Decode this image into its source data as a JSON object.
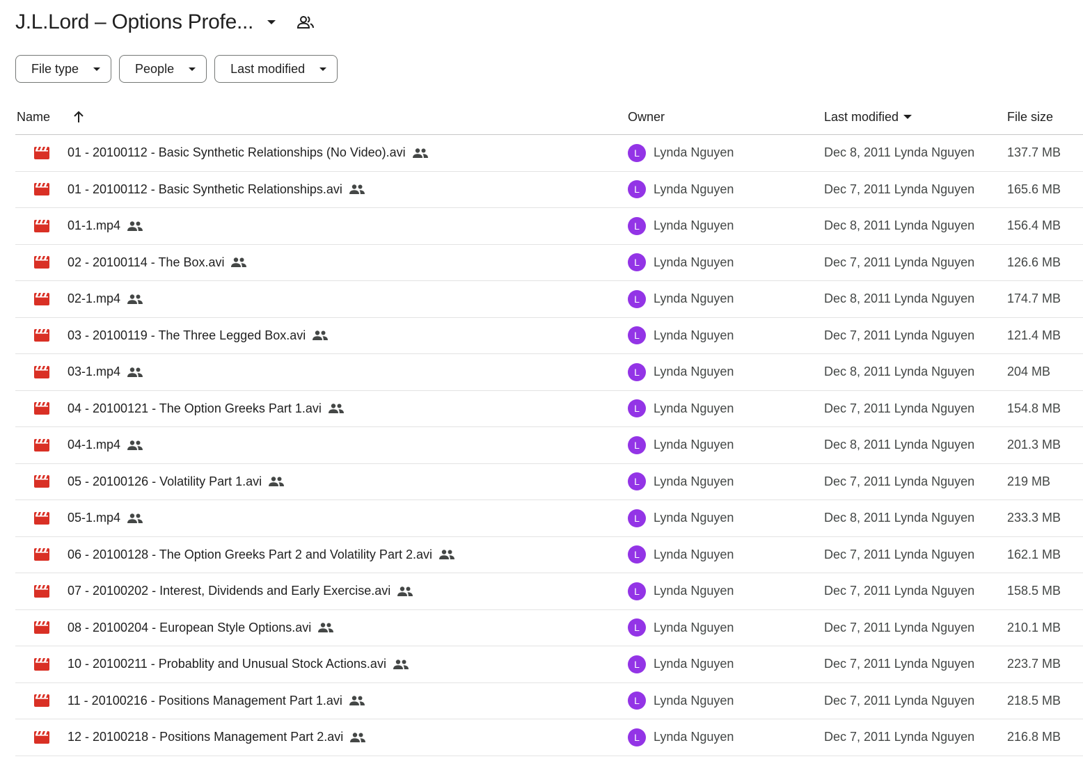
{
  "folder": {
    "title": "J.L.Lord – Options Profe..."
  },
  "filters": {
    "file_type": "File type",
    "people": "People",
    "last_modified": "Last modified"
  },
  "table": {
    "headers": {
      "name": "Name",
      "owner": "Owner",
      "last_modified": "Last modified",
      "file_size": "File size"
    },
    "rows": [
      {
        "name": "01 - 20100112 - Basic Synthetic Relationships (No Video).avi",
        "owner": "Lynda Nguyen",
        "avatar": "L",
        "modified": "Dec 8, 2011",
        "modified_by": "Lynda Nguyen",
        "size": "137.7 MB"
      },
      {
        "name": "01 - 20100112 - Basic Synthetic Relationships.avi",
        "owner": "Lynda Nguyen",
        "avatar": "L",
        "modified": "Dec 7, 2011",
        "modified_by": "Lynda Nguyen",
        "size": "165.6 MB"
      },
      {
        "name": "01-1.mp4",
        "owner": "Lynda Nguyen",
        "avatar": "L",
        "modified": "Dec 8, 2011",
        "modified_by": "Lynda Nguyen",
        "size": "156.4 MB"
      },
      {
        "name": "02 - 20100114 - The Box.avi",
        "owner": "Lynda Nguyen",
        "avatar": "L",
        "modified": "Dec 7, 2011",
        "modified_by": "Lynda Nguyen",
        "size": "126.6 MB"
      },
      {
        "name": "02-1.mp4",
        "owner": "Lynda Nguyen",
        "avatar": "L",
        "modified": "Dec 8, 2011",
        "modified_by": "Lynda Nguyen",
        "size": "174.7 MB"
      },
      {
        "name": "03 - 20100119 - The Three Legged Box.avi",
        "owner": "Lynda Nguyen",
        "avatar": "L",
        "modified": "Dec 7, 2011",
        "modified_by": "Lynda Nguyen",
        "size": "121.4 MB"
      },
      {
        "name": "03-1.mp4",
        "owner": "Lynda Nguyen",
        "avatar": "L",
        "modified": "Dec 8, 2011",
        "modified_by": "Lynda Nguyen",
        "size": "204 MB"
      },
      {
        "name": "04 - 20100121 - The Option Greeks Part 1.avi",
        "owner": "Lynda Nguyen",
        "avatar": "L",
        "modified": "Dec 7, 2011",
        "modified_by": "Lynda Nguyen",
        "size": "154.8 MB"
      },
      {
        "name": "04-1.mp4",
        "owner": "Lynda Nguyen",
        "avatar": "L",
        "modified": "Dec 8, 2011",
        "modified_by": "Lynda Nguyen",
        "size": "201.3 MB"
      },
      {
        "name": "05 - 20100126 - Volatility Part 1.avi",
        "owner": "Lynda Nguyen",
        "avatar": "L",
        "modified": "Dec 7, 2011",
        "modified_by": "Lynda Nguyen",
        "size": "219 MB"
      },
      {
        "name": "05-1.mp4",
        "owner": "Lynda Nguyen",
        "avatar": "L",
        "modified": "Dec 8, 2011",
        "modified_by": "Lynda Nguyen",
        "size": "233.3 MB"
      },
      {
        "name": "06 - 20100128 - The Option Greeks Part 2 and Volatility Part 2.avi",
        "owner": "Lynda Nguyen",
        "avatar": "L",
        "modified": "Dec 7, 2011",
        "modified_by": "Lynda Nguyen",
        "size": "162.1 MB"
      },
      {
        "name": "07 - 20100202 - Interest, Dividends and Early Exercise.avi",
        "owner": "Lynda Nguyen",
        "avatar": "L",
        "modified": "Dec 7, 2011",
        "modified_by": "Lynda Nguyen",
        "size": "158.5 MB"
      },
      {
        "name": "08 - 20100204 - European Style Options.avi",
        "owner": "Lynda Nguyen",
        "avatar": "L",
        "modified": "Dec 7, 2011",
        "modified_by": "Lynda Nguyen",
        "size": "210.1 MB"
      },
      {
        "name": "10 - 20100211 - Probablity and Unusual Stock Actions.avi",
        "owner": "Lynda Nguyen",
        "avatar": "L",
        "modified": "Dec 7, 2011",
        "modified_by": "Lynda Nguyen",
        "size": "223.7 MB"
      },
      {
        "name": "11 - 20100216 - Positions Management Part 1.avi",
        "owner": "Lynda Nguyen",
        "avatar": "L",
        "modified": "Dec 7, 2011",
        "modified_by": "Lynda Nguyen",
        "size": "218.5 MB"
      },
      {
        "name": "12 - 20100218 - Positions Management Part 2.avi",
        "owner": "Lynda Nguyen",
        "avatar": "L",
        "modified": "Dec 7, 2011",
        "modified_by": "Lynda Nguyen",
        "size": "216.8 MB"
      }
    ]
  },
  "icons": {
    "file_icon": "video-file-icon",
    "shared_icon": "people-icon",
    "sort_icon": "arrow-up-icon",
    "dropdown_icon": "caret-down-icon"
  },
  "colors": {
    "video_icon": "#d93025",
    "avatar": "#9334e6",
    "text_primary": "#1f1f1f",
    "text_secondary": "#444746",
    "chip_border": "#747775"
  }
}
